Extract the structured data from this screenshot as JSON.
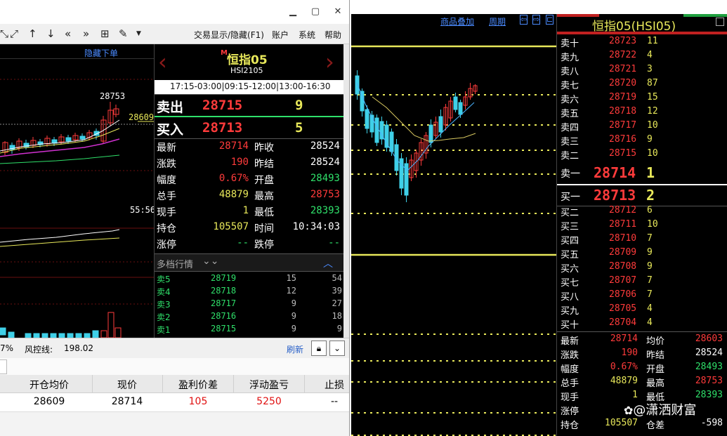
{
  "left_window": {
    "toolbar_menus": [
      "交易显示/隐藏(F1)",
      "账户",
      "系统",
      "帮助"
    ],
    "hide_order_label": "隐藏下单",
    "chart": {
      "high_label": "28753",
      "price_tag": "28609",
      "time_label": "55:56"
    },
    "quote": {
      "marker": "M",
      "name": "恒指05",
      "code": "HSI2105",
      "sessions": "17:15-03:00|09:15-12:00|13:00-16:30",
      "sell": {
        "label": "卖出",
        "price": "28715",
        "vol": "9"
      },
      "buy": {
        "label": "买入",
        "price": "28713",
        "vol": "5"
      },
      "rows": [
        {
          "l1": "最新",
          "v1": "28714",
          "c1": "red",
          "l2": "昨收",
          "v2": "28524",
          "c2": "white"
        },
        {
          "l1": "涨跌",
          "v1": "190",
          "c1": "red",
          "l2": "昨结",
          "v2": "28524",
          "c2": "white"
        },
        {
          "l1": "幅度",
          "v1": "0.67%",
          "c1": "red",
          "l2": "开盘",
          "v2": "28493",
          "c2": "green"
        },
        {
          "l1": "总手",
          "v1": "48879",
          "c1": "yellow",
          "l2": "最高",
          "v2": "28753",
          "c2": "red"
        },
        {
          "l1": "现手",
          "v1": "1",
          "c1": "yellow",
          "l2": "最低",
          "v2": "28393",
          "c2": "green"
        },
        {
          "l1": "持仓",
          "v1": "105507",
          "c1": "yellow",
          "l2": "时间",
          "v2": "10:34:03",
          "c2": "white"
        },
        {
          "l1": "涨停",
          "v1": "--",
          "c1": "green",
          "l2": "跌停",
          "v2": "--",
          "c2": "green"
        }
      ],
      "depth_title": "多档行情",
      "depth": [
        {
          "label": "卖5",
          "price": "28719",
          "v1": "15",
          "v2": "54"
        },
        {
          "label": "卖4",
          "price": "28718",
          "v1": "12",
          "v2": "39"
        },
        {
          "label": "卖3",
          "price": "28717",
          "v1": "9",
          "v2": "27"
        },
        {
          "label": "卖2",
          "price": "28716",
          "v1": "9",
          "v2": "18"
        },
        {
          "label": "卖1",
          "price": "28715",
          "v1": "9",
          "v2": "9"
        }
      ]
    },
    "status": {
      "pct": "7%",
      "risk_label": "风控线:",
      "risk_value": "198.02",
      "refresh": "刷新"
    },
    "table": {
      "headers": [
        "开仓均价",
        "现价",
        "盈利价差",
        "浮动盈亏",
        "止损"
      ],
      "row": [
        "28609",
        "28714",
        "105",
        "5250",
        "--"
      ]
    }
  },
  "right_app": {
    "top_links": [
      "商品叠加",
      "周期"
    ],
    "title": "恒指05(HSI05)",
    "asks": [
      {
        "label": "卖十",
        "price": "28723",
        "vol": "11"
      },
      {
        "label": "卖九",
        "price": "28722",
        "vol": "4"
      },
      {
        "label": "卖八",
        "price": "28721",
        "vol": "3"
      },
      {
        "label": "卖七",
        "price": "28720",
        "vol": "87"
      },
      {
        "label": "卖六",
        "price": "28719",
        "vol": "15"
      },
      {
        "label": "卖五",
        "price": "28718",
        "vol": "12"
      },
      {
        "label": "卖四",
        "price": "28717",
        "vol": "10"
      },
      {
        "label": "卖三",
        "price": "28716",
        "vol": "9"
      },
      {
        "label": "卖二",
        "price": "28715",
        "vol": "10"
      }
    ],
    "ask1": {
      "label": "卖一",
      "price": "28714",
      "vol": "1"
    },
    "bid1": {
      "label": "买一",
      "price": "28713",
      "vol": "2"
    },
    "bids": [
      {
        "label": "买二",
        "price": "28712",
        "vol": "6"
      },
      {
        "label": "买三",
        "price": "28711",
        "vol": "10"
      },
      {
        "label": "买四",
        "price": "28710",
        "vol": "7"
      },
      {
        "label": "买五",
        "price": "28709",
        "vol": "9"
      },
      {
        "label": "买六",
        "price": "28708",
        "vol": "9"
      },
      {
        "label": "买七",
        "price": "28707",
        "vol": "7"
      },
      {
        "label": "买八",
        "price": "28706",
        "vol": "7"
      },
      {
        "label": "买九",
        "price": "28705",
        "vol": "4"
      },
      {
        "label": "买十",
        "price": "28704",
        "vol": "4"
      }
    ],
    "bottom": [
      {
        "l1": "最新",
        "v1": "28714",
        "c1": "red",
        "l2": "均价",
        "v2": "28603",
        "c2": "red"
      },
      {
        "l1": "涨跌",
        "v1": "190",
        "c1": "red",
        "l2": "昨结",
        "v2": "28524",
        "c2": "white"
      },
      {
        "l1": "幅度",
        "v1": "0.67%",
        "c1": "red",
        "l2": "开盘",
        "v2": "28493",
        "c2": "green"
      },
      {
        "l1": "总手",
        "v1": "48879",
        "c1": "yellow",
        "l2": "最高",
        "v2": "28753",
        "c2": "red"
      },
      {
        "l1": "现手",
        "v1": "1",
        "c1": "yellow",
        "l2": "最低",
        "v2": "28393",
        "c2": "green"
      },
      {
        "l1": "涨停",
        "v1": "",
        "c1": "green",
        "l2": "",
        "v2": "",
        "c2": "green"
      },
      {
        "l1": "持仓",
        "v1": "105507",
        "c1": "yellow",
        "l2": "仓差",
        "v2": "-598",
        "c2": "white"
      }
    ]
  },
  "watermark": "@潇洒财富"
}
